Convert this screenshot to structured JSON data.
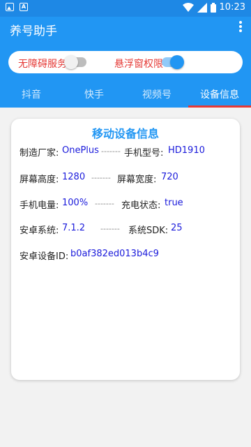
{
  "status": {
    "time": "10:23"
  },
  "appbar": {
    "title": "养号助手"
  },
  "permissions": {
    "accessibility": {
      "label": "无障碍服务",
      "enabled": false
    },
    "overlay": {
      "label": "悬浮窗权限",
      "enabled": true
    }
  },
  "tabs": [
    {
      "label": "抖音"
    },
    {
      "label": "快手"
    },
    {
      "label": "视频号"
    },
    {
      "label": "设备信息",
      "active": true
    }
  ],
  "card": {
    "title": "移动设备信息",
    "separator": "-------",
    "rows": [
      {
        "l1": "制造厂家:",
        "v1": "OnePlus",
        "l2": "手机型号:",
        "v2": "HD1910"
      },
      {
        "l1": "屏幕高度:",
        "v1": "1280",
        "l2": "屏幕宽度:",
        "v2": "720"
      },
      {
        "l1": "手机电量:",
        "v1": "100%",
        "l2": "充电状态:",
        "v2": "true"
      },
      {
        "l1": "安卓系统:",
        "v1": "7.1.2",
        "l2": "系统SDK:",
        "v2": "25"
      }
    ],
    "android_id": {
      "label": "安卓设备ID:",
      "value": "b0af382ed013b4c9"
    }
  },
  "colors": {
    "primary": "#2196f3",
    "status_bar": "#1e88e5",
    "accent_red": "#e53935",
    "value_blue": "#1a1adb"
  }
}
